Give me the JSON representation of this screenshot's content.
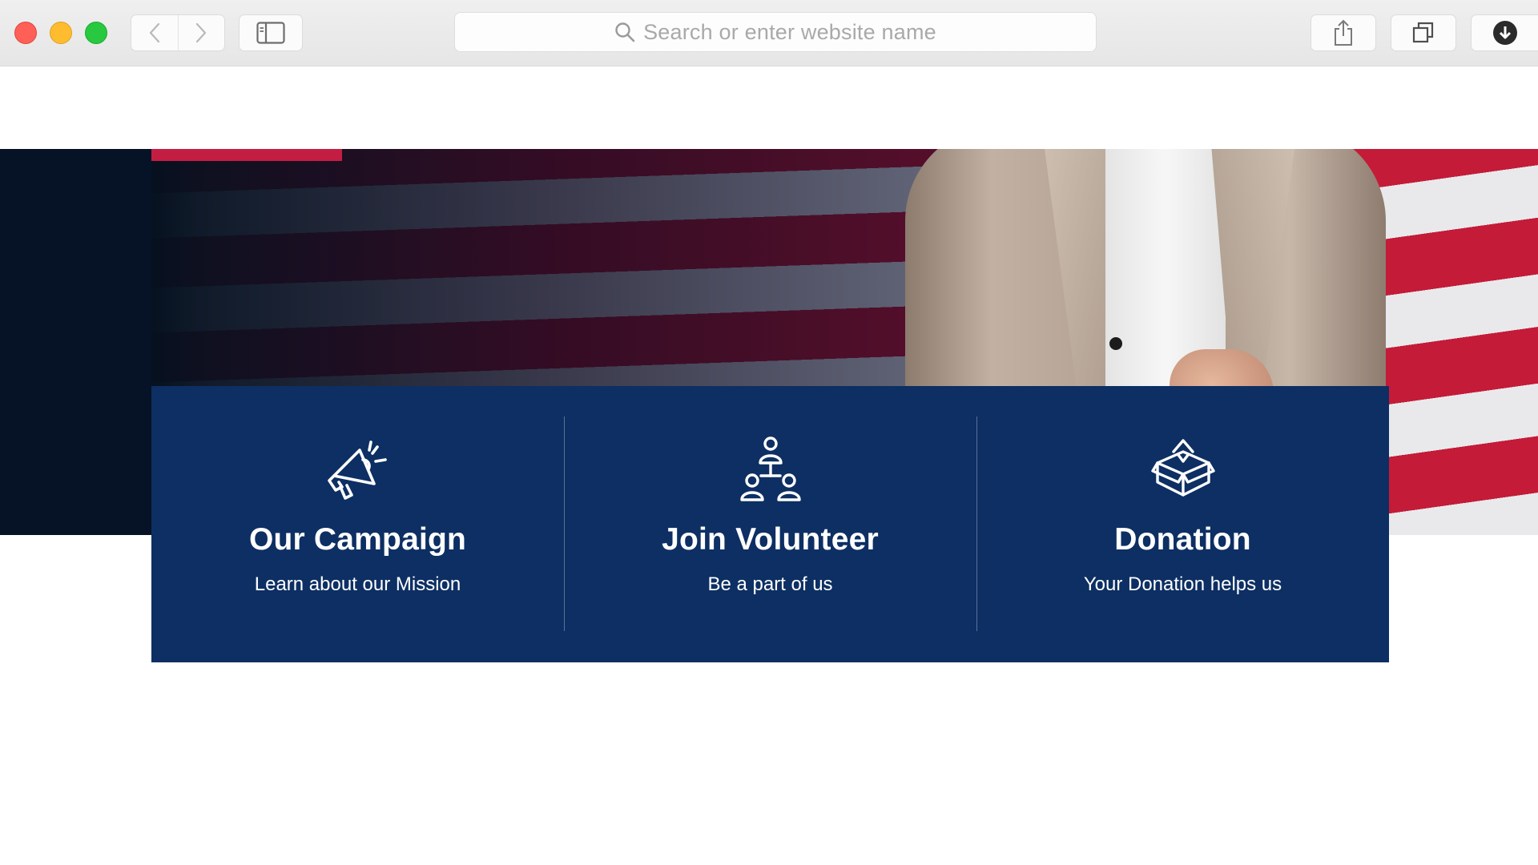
{
  "browser": {
    "url_placeholder": "Search or enter website name",
    "icons": [
      "back-icon",
      "forward-icon",
      "sidebar-icon",
      "search-icon",
      "share-icon",
      "tabs-icon",
      "download-icon"
    ]
  },
  "colors": {
    "panel": "#0d2f63",
    "accent": "#c41d43",
    "hero_dark": "#061225"
  },
  "features": [
    {
      "icon": "megaphone-icon",
      "title": "Our Campaign",
      "subtitle": "Learn about our Mission"
    },
    {
      "icon": "people-network-icon",
      "title": "Join Volunteer",
      "subtitle": "Be a part of us"
    },
    {
      "icon": "donation-box-icon",
      "title": "Donation",
      "subtitle": "Your Donation helps us"
    }
  ]
}
